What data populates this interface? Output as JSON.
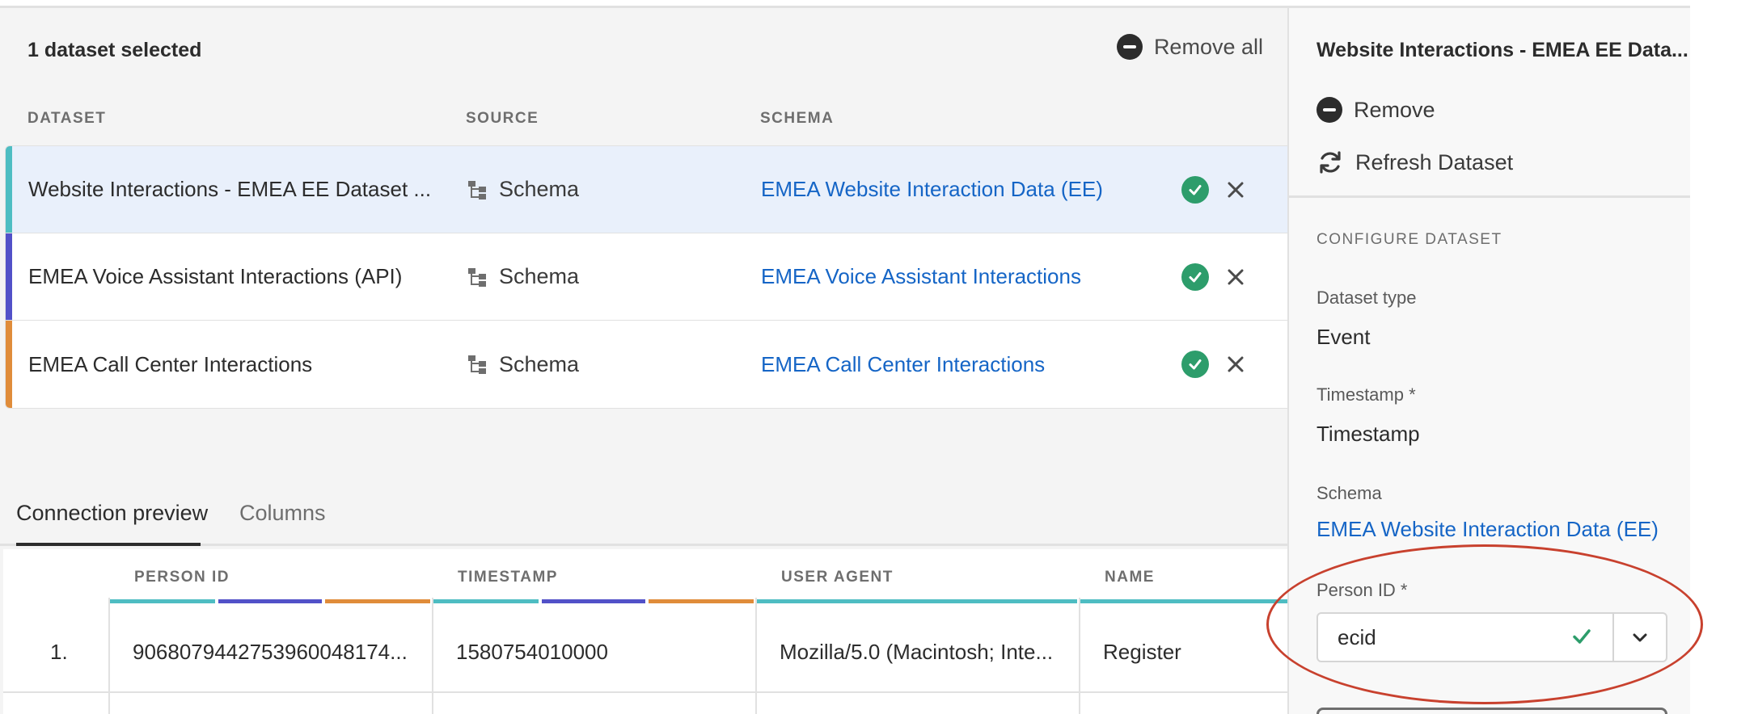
{
  "header": {
    "selected_count_text": "1 dataset selected",
    "remove_all_label": "Remove all"
  },
  "columns": {
    "dataset": "DATASET",
    "source": "SOURCE",
    "schema": "SCHEMA"
  },
  "datasets": [
    {
      "name": "Website Interactions - EMEA EE Dataset ...",
      "source": "Schema",
      "schema": "EMEA Website Interaction Data (EE)",
      "color": "#4ebdc2",
      "selected": true
    },
    {
      "name": "EMEA Voice Assistant Interactions (API)",
      "source": "Schema",
      "schema": "EMEA Voice Assistant Interactions",
      "color": "#5251c8",
      "selected": false
    },
    {
      "name": "EMEA Call Center Interactions",
      "source": "Schema",
      "schema": "EMEA Call Center Interactions",
      "color": "#e08c3a",
      "selected": false
    }
  ],
  "tabs": [
    {
      "label": "Connection preview",
      "active": true
    },
    {
      "label": "Columns",
      "active": false
    }
  ],
  "preview": {
    "headers": [
      "PERSON ID",
      "TIMESTAMP",
      "USER AGENT",
      "NAME"
    ],
    "rows": [
      {
        "num": "1.",
        "person_id": "906807944275396004817​4...",
        "timestamp": "1580754010000",
        "user_agent": "Mozilla/5.0 (Macintosh; Inte...",
        "name": "Register"
      }
    ]
  },
  "panel": {
    "title": "Website Interactions - EMEA EE Data...",
    "remove_label": "Remove",
    "refresh_label": "Refresh Dataset",
    "section_label": "CONFIGURE DATASET",
    "dataset_type_label": "Dataset type",
    "dataset_type_value": "Event",
    "timestamp_label": "Timestamp *",
    "timestamp_value": "Timestamp",
    "schema_label": "Schema",
    "schema_value": "EMEA Website Interaction Data (EE)",
    "person_id_label": "Person ID *",
    "person_id_value": "ecid"
  },
  "colors": {
    "accent_link": "#1565c6",
    "success": "#2d9d6b",
    "highlight": "#c8412e",
    "teal": "#4ebdc2",
    "indigo": "#5251c8",
    "orange": "#e08c3a"
  },
  "icons": [
    "minus-circle-icon",
    "schema-icon",
    "check-circle-icon",
    "close-icon",
    "refresh-icon",
    "checkmark-icon",
    "chevron-down-icon"
  ]
}
